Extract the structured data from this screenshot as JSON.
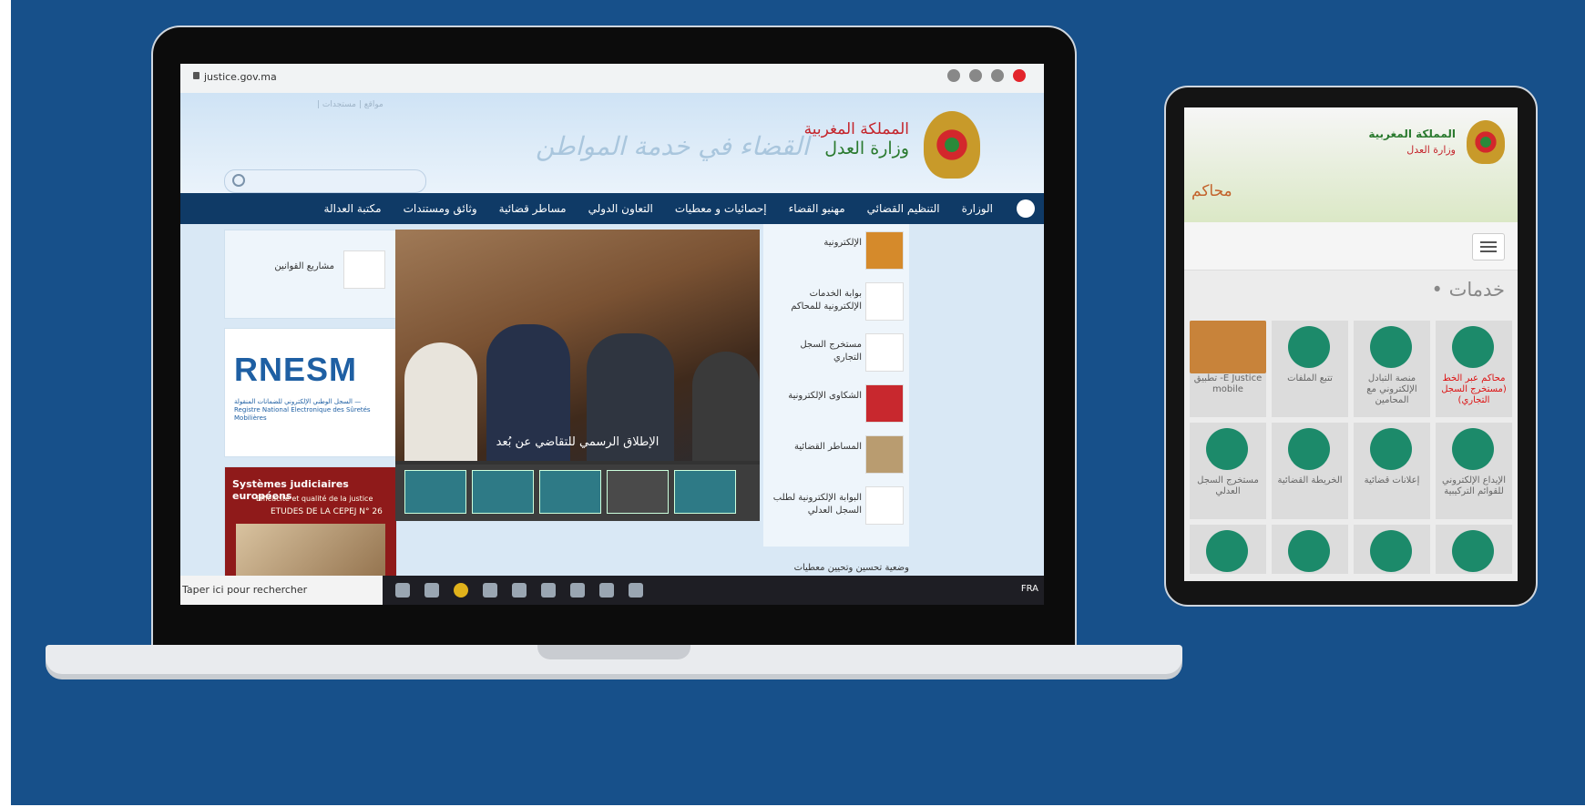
{
  "browser": {
    "url": "justice.gov.ma"
  },
  "site": {
    "header_links": "| مواقع | مستجدات",
    "ministry_line1": "المملكة المغربية",
    "ministry_line2": "وزارة العدل",
    "slogan": "القضاء في خدمة المواطن",
    "nav": [
      "الوزارة",
      "التنظيم القضائي",
      "مهنيو القضاء",
      "إحصائيات و معطيات",
      "التعاون الدولي",
      "مساطر قضائية",
      "وثائق ومستندات",
      "مكتبة العدالة"
    ]
  },
  "left": {
    "laws_label": "مشاريع القوانين",
    "rnesm_title": "RNESM",
    "rnesm_sub": "السجل الوطني الإلكتروني للضمانات المنقولة — Registre National Electronique des Sûretés Mobilières",
    "book_t1": "Systèmes judiciaires européens",
    "book_t2": "Efficacité et qualité de la justice",
    "book_t3": "ETUDES DE LA CEPEJ N° 26"
  },
  "slider": {
    "caption": "الإطلاق الرسمي للتقاضي عن بُعد"
  },
  "services": [
    "الإلكترونية",
    "بوابة الخدمات الإلكترونية للمحاكم",
    "مستخرج السجل التجاري",
    "الشكاوى الإلكترونية",
    "المساطر القضائية",
    "البوابة الإلكترونية لطلب السجل العدلي"
  ],
  "right_footer": "وضعية تحسين وتحيين معطيات",
  "taskbar": {
    "search_text": "Taper ici pour rechercher",
    "lang": "FRA"
  },
  "tablet": {
    "ministry_line1": "المملكة المغربية",
    "ministry_line2": "وزارة العدل",
    "brand": "محاكم",
    "section_title": "• خدمات",
    "tiles": [
      {
        "label": "تطبيق -E Justice mobile",
        "icon": "e-justice-icon"
      },
      {
        "label": "تتبع الملفات",
        "icon": "file-search-icon"
      },
      {
        "label": "منصة التبادل الإلكتروني مع المحامين",
        "icon": "doc-add-icon"
      },
      {
        "label": "محاكم عبر الخط (مستخرج السجل التجاري)",
        "icon": "doc-add-icon"
      },
      {
        "label": "مستخرج السجل العدلي",
        "icon": "doc-check-icon"
      },
      {
        "label": "الخريطة القضائية",
        "icon": "map-pin-icon"
      },
      {
        "label": "إعلانات قضائية",
        "icon": "megaphone-icon"
      },
      {
        "label": "الإيداع الإلكتروني للقوائم التركيبية",
        "icon": "card-icon"
      },
      {
        "label": "",
        "icon": "doc-icon"
      },
      {
        "label": "",
        "icon": "monitor-icon"
      },
      {
        "label": "",
        "icon": "rings-icon"
      },
      {
        "label": "",
        "icon": "doc-add-icon"
      }
    ]
  },
  "colors": {
    "background": "#17508a",
    "nav": "#0f3a66",
    "tile_icon": "#1c8a6a"
  }
}
